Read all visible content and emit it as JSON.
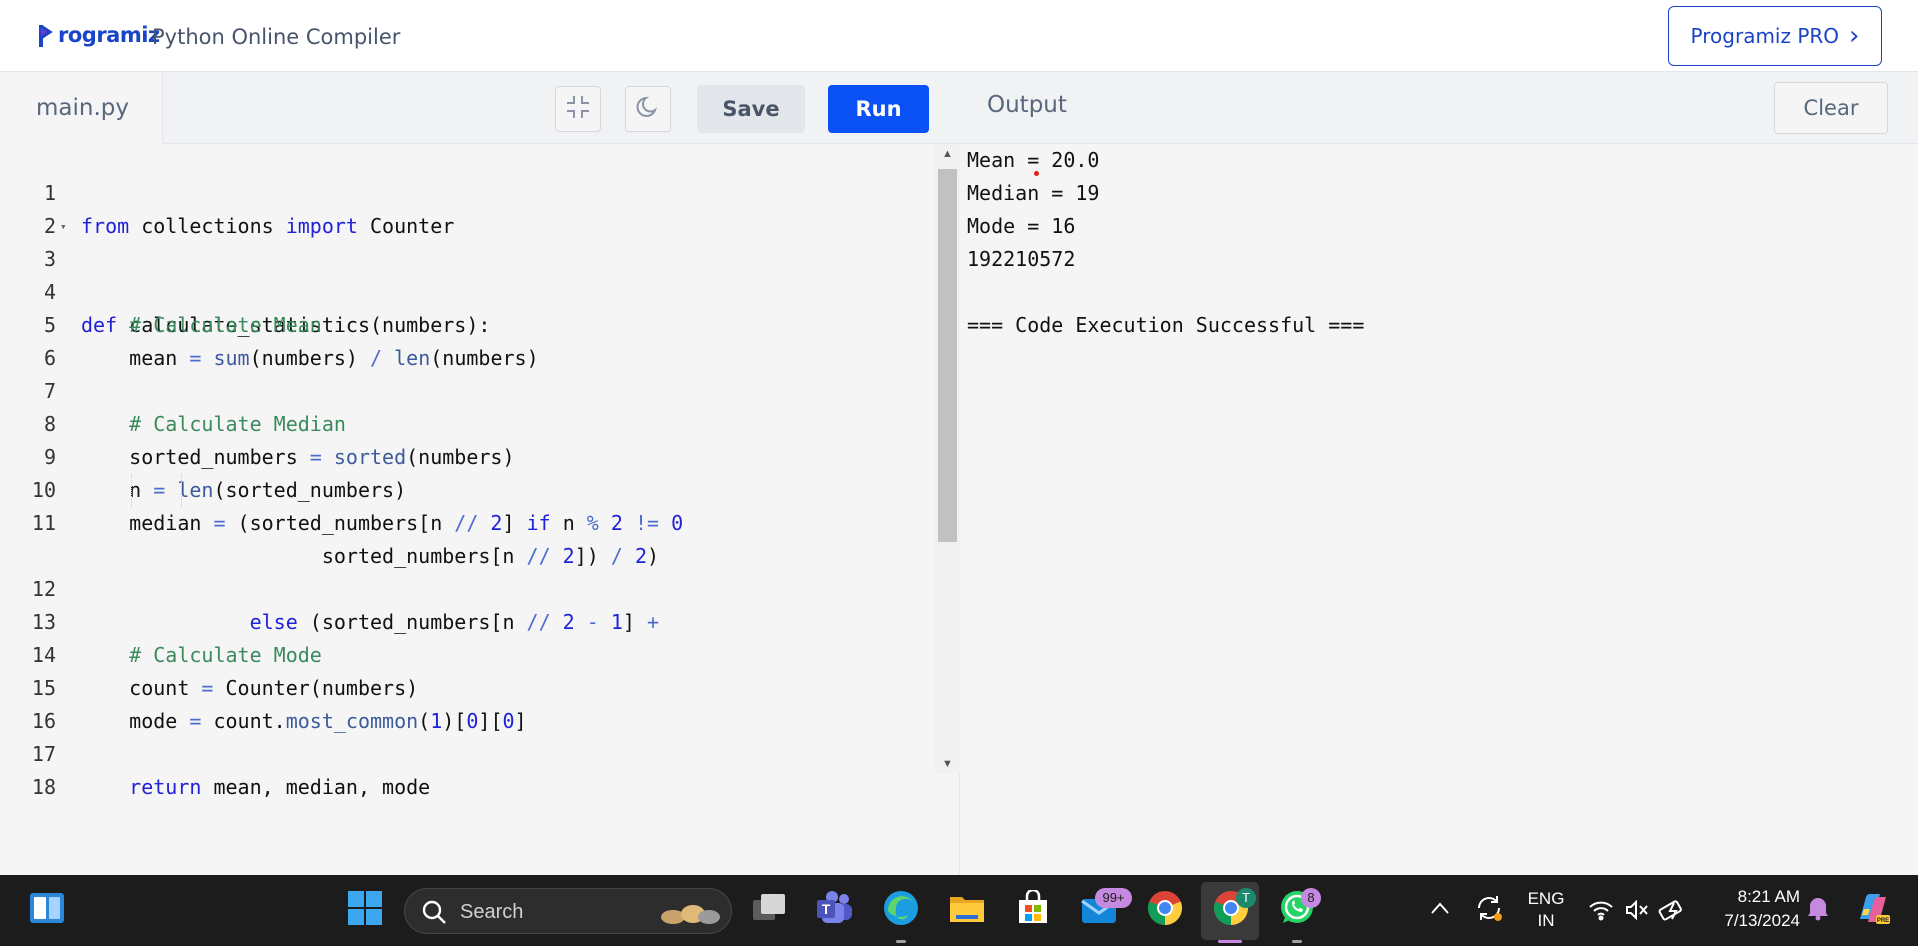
{
  "header": {
    "logo_text": "rogramiz",
    "app_title": "Python Online Compiler",
    "pro_button": "Programiz PRO",
    "pro_chevron": "›"
  },
  "editor": {
    "file_tab": "main.py",
    "save_label": "Save",
    "run_label": "Run",
    "line_numbers": [
      "1",
      "2",
      "3",
      "4",
      "5",
      "6",
      "7",
      "8",
      "9",
      "10",
      "11",
      "12",
      "13",
      "14",
      "15",
      "16",
      "17",
      "18"
    ],
    "lines": [
      "from collections import Counter",
      "",
      "def calculate_statistics(numbers):",
      "    # Calculate Mean",
      "    mean = sum(numbers) / len(numbers)",
      "",
      "    # Calculate Median",
      "    sorted_numbers = sorted(numbers)",
      "    n = len(sorted_numbers)",
      "    median = (sorted_numbers[n // 2] if n % 2 != 0",
      "              else (sorted_numbers[n // 2 - 1] +",
      "                    sorted_numbers[n // 2]) / 2)",
      "",
      "    # Calculate Mode",
      "    count = Counter(numbers)",
      "    mode = count.most_common(1)[0][0]",
      "",
      "    return mean, median, mode",
      ""
    ]
  },
  "output": {
    "title": "Output",
    "clear_label": "Clear",
    "lines": [
      "Mean = 20.0",
      "Median = 19",
      "Mode = 16",
      "192210572",
      "",
      "=== Code Execution Successful ==="
    ]
  },
  "taskbar": {
    "search_label": "Search",
    "mail_badge": "99+",
    "chrome_profile": "T",
    "whatsapp_badge": "8",
    "language": "ENG",
    "region": "IN",
    "time": "8:21 AM",
    "date": "7/13/2024",
    "colors": {
      "background": "#1c1c1c",
      "accent": "#0a52f5"
    }
  }
}
